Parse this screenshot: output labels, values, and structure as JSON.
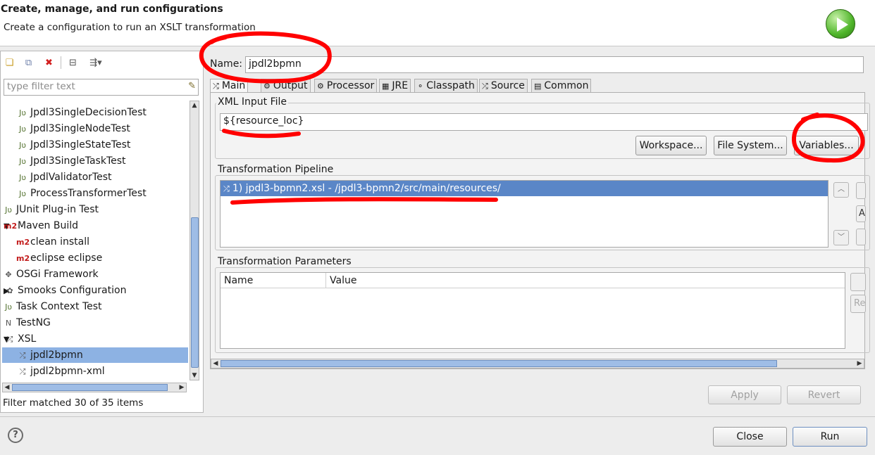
{
  "header": {
    "title": "Create, manage, and run configurations",
    "subtitle": "Create a configuration to run an XSLT transformation"
  },
  "toolbar": {
    "icons": [
      "new-config-icon",
      "duplicate-config-icon",
      "delete-config-icon",
      "collapse-all-icon",
      "filter-menu-icon"
    ]
  },
  "filter": {
    "placeholder": "type filter text"
  },
  "tree": [
    {
      "label": "Jpdl3SingleDecisionTest",
      "icon": "Jʋ",
      "indent": 40
    },
    {
      "label": "Jpdl3SingleNodeTest",
      "icon": "Jʋ",
      "indent": 40
    },
    {
      "label": "Jpdl3SingleStateTest",
      "icon": "Jʋ",
      "indent": 40
    },
    {
      "label": "Jpdl3SingleTaskTest",
      "icon": "Jʋ",
      "indent": 40
    },
    {
      "label": "JpdlValidatorTest",
      "icon": "Jʋ",
      "indent": 40
    },
    {
      "label": "ProcessTransformerTest",
      "icon": "Jʋ",
      "indent": 40
    },
    {
      "label": "JUnit Plug-in Test",
      "icon": "Jʋ",
      "indent": 20
    },
    {
      "label": "Maven Build",
      "icon": "m2",
      "indent": 20,
      "expander": "▼"
    },
    {
      "label": "clean install",
      "icon": "m2",
      "indent": 40
    },
    {
      "label": "eclipse eclipse",
      "icon": "m2",
      "indent": 40
    },
    {
      "label": "OSGi Framework",
      "icon": "✥",
      "indent": 20
    },
    {
      "label": "Smooks Configuration",
      "icon": "✿",
      "indent": 20,
      "expander": "▶"
    },
    {
      "label": "Task Context Test",
      "icon": "Jʋ",
      "indent": 20
    },
    {
      "label": "TestNG",
      "icon": "N",
      "indent": 20
    },
    {
      "label": "XSL",
      "icon": "⤮",
      "indent": 20,
      "expander": "▼"
    },
    {
      "label": "jpdl2bpmn",
      "icon": "⤮",
      "indent": 40,
      "selected": true
    },
    {
      "label": "jpdl2bpmn-xml",
      "icon": "⤮",
      "indent": 40
    }
  ],
  "status": {
    "filtered": "Filter matched 30 of 35 items"
  },
  "name": {
    "label": "Name:",
    "value": "jpdl2bpmn"
  },
  "tabs": [
    {
      "label": "Main",
      "icon": "⤮"
    },
    {
      "label": "Output",
      "icon": "⚙"
    },
    {
      "label": "Processor",
      "icon": "⚙"
    },
    {
      "label": "JRE",
      "icon": "▦"
    },
    {
      "label": "Classpath",
      "icon": "⚬"
    },
    {
      "label": "Source",
      "icon": "⤮"
    },
    {
      "label": "Common",
      "icon": "▤"
    }
  ],
  "xml_input": {
    "title": "XML Input File",
    "value": "${resource_loc}",
    "buttons": {
      "workspace": "Workspace...",
      "filesystem": "File System...",
      "variables": "Variables..."
    }
  },
  "pipeline": {
    "title": "Transformation Pipeline",
    "item": "1) jpdl3-bpmn2.xsl - /jpdl3-bpmn2/src/main/resources/",
    "side_add": "A"
  },
  "params": {
    "title": "Transformation Parameters",
    "columns": [
      "Name",
      "Value"
    ],
    "side_remove": "Re"
  },
  "actions": {
    "apply": "Apply",
    "revert": "Revert",
    "close": "Close",
    "run": "Run"
  },
  "colors": {
    "selection": "#8db2e3",
    "list_selection": "#5a86c7",
    "annotation": "#ff0000"
  }
}
